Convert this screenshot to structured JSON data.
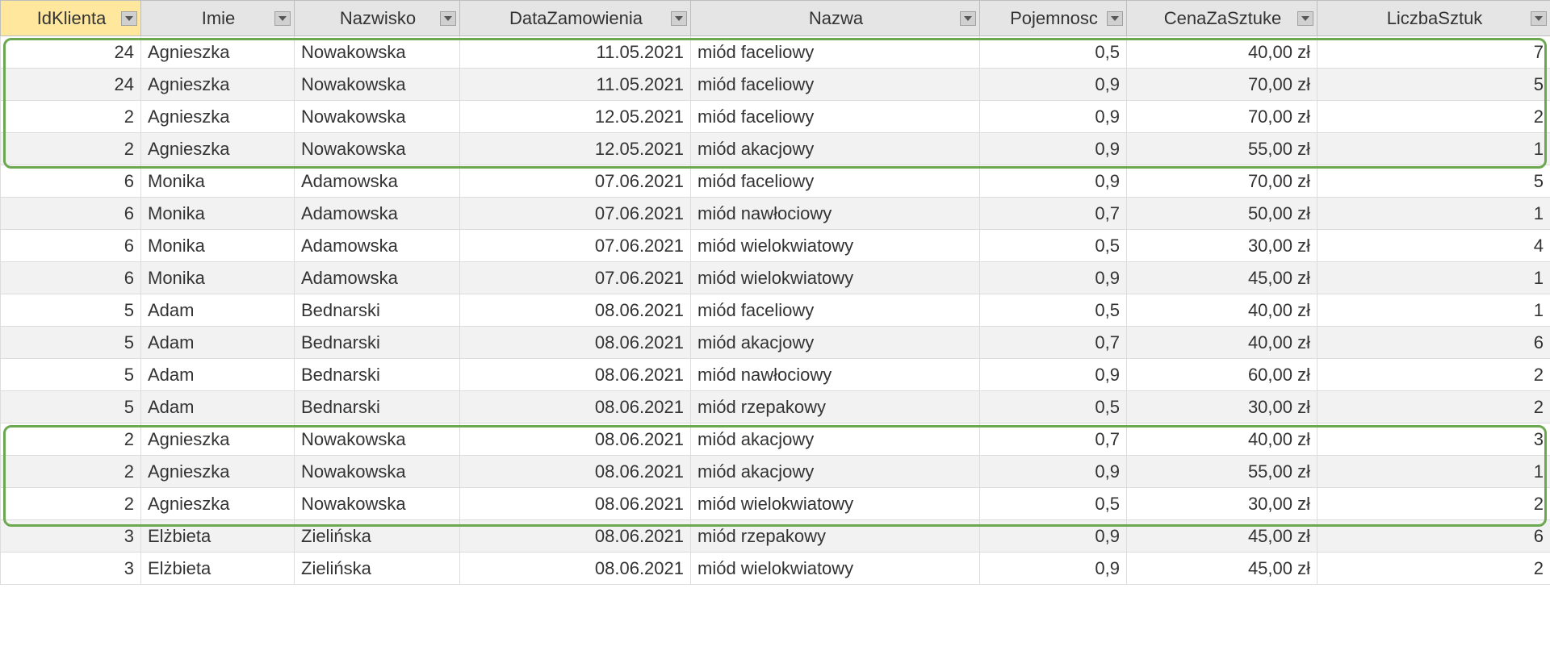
{
  "headers": {
    "id": "IdKlienta",
    "imie": "Imie",
    "nazwisko": "Nazwisko",
    "data": "DataZamowienia",
    "nazwa": "Nazwa",
    "pojemnosc": "Pojemnosc",
    "cena": "CenaZaSztuke",
    "liczba": "LiczbaSztuk"
  },
  "rows": [
    {
      "id": "24",
      "imie": "Agnieszka",
      "nazwisko": "Nowakowska",
      "data": "11.05.2021",
      "nazwa": "miód faceliowy",
      "poj": "0,5",
      "cena": "40,00 zł",
      "liczba": "7"
    },
    {
      "id": "24",
      "imie": "Agnieszka",
      "nazwisko": "Nowakowska",
      "data": "11.05.2021",
      "nazwa": "miód faceliowy",
      "poj": "0,9",
      "cena": "70,00 zł",
      "liczba": "5"
    },
    {
      "id": "2",
      "imie": "Agnieszka",
      "nazwisko": "Nowakowska",
      "data": "12.05.2021",
      "nazwa": "miód faceliowy",
      "poj": "0,9",
      "cena": "70,00 zł",
      "liczba": "2"
    },
    {
      "id": "2",
      "imie": "Agnieszka",
      "nazwisko": "Nowakowska",
      "data": "12.05.2021",
      "nazwa": "miód akacjowy",
      "poj": "0,9",
      "cena": "55,00 zł",
      "liczba": "1"
    },
    {
      "id": "6",
      "imie": "Monika",
      "nazwisko": "Adamowska",
      "data": "07.06.2021",
      "nazwa": "miód faceliowy",
      "poj": "0,9",
      "cena": "70,00 zł",
      "liczba": "5"
    },
    {
      "id": "6",
      "imie": "Monika",
      "nazwisko": "Adamowska",
      "data": "07.06.2021",
      "nazwa": "miód nawłociowy",
      "poj": "0,7",
      "cena": "50,00 zł",
      "liczba": "1"
    },
    {
      "id": "6",
      "imie": "Monika",
      "nazwisko": "Adamowska",
      "data": "07.06.2021",
      "nazwa": "miód wielokwiatowy",
      "poj": "0,5",
      "cena": "30,00 zł",
      "liczba": "4"
    },
    {
      "id": "6",
      "imie": "Monika",
      "nazwisko": "Adamowska",
      "data": "07.06.2021",
      "nazwa": "miód wielokwiatowy",
      "poj": "0,9",
      "cena": "45,00 zł",
      "liczba": "1"
    },
    {
      "id": "5",
      "imie": "Adam",
      "nazwisko": "Bednarski",
      "data": "08.06.2021",
      "nazwa": "miód faceliowy",
      "poj": "0,5",
      "cena": "40,00 zł",
      "liczba": "1"
    },
    {
      "id": "5",
      "imie": "Adam",
      "nazwisko": "Bednarski",
      "data": "08.06.2021",
      "nazwa": "miód akacjowy",
      "poj": "0,7",
      "cena": "40,00 zł",
      "liczba": "6"
    },
    {
      "id": "5",
      "imie": "Adam",
      "nazwisko": "Bednarski",
      "data": "08.06.2021",
      "nazwa": "miód nawłociowy",
      "poj": "0,9",
      "cena": "60,00 zł",
      "liczba": "2"
    },
    {
      "id": "5",
      "imie": "Adam",
      "nazwisko": "Bednarski",
      "data": "08.06.2021",
      "nazwa": "miód rzepakowy",
      "poj": "0,5",
      "cena": "30,00 zł",
      "liczba": "2"
    },
    {
      "id": "2",
      "imie": "Agnieszka",
      "nazwisko": "Nowakowska",
      "data": "08.06.2021",
      "nazwa": "miód akacjowy",
      "poj": "0,7",
      "cena": "40,00 zł",
      "liczba": "3"
    },
    {
      "id": "2",
      "imie": "Agnieszka",
      "nazwisko": "Nowakowska",
      "data": "08.06.2021",
      "nazwa": "miód akacjowy",
      "poj": "0,9",
      "cena": "55,00 zł",
      "liczba": "1"
    },
    {
      "id": "2",
      "imie": "Agnieszka",
      "nazwisko": "Nowakowska",
      "data": "08.06.2021",
      "nazwa": "miód wielokwiatowy",
      "poj": "0,5",
      "cena": "30,00 zł",
      "liczba": "2"
    },
    {
      "id": "3",
      "imie": "Elżbieta",
      "nazwisko": "Zielińska",
      "data": "08.06.2021",
      "nazwa": "miód rzepakowy",
      "poj": "0,9",
      "cena": "45,00 zł",
      "liczba": "6"
    },
    {
      "id": "3",
      "imie": "Elżbieta",
      "nazwisko": "Zielińska",
      "data": "08.06.2021",
      "nazwa": "miód wielokwiatowy",
      "poj": "0,9",
      "cena": "45,00 zł",
      "liczba": "2"
    }
  ]
}
